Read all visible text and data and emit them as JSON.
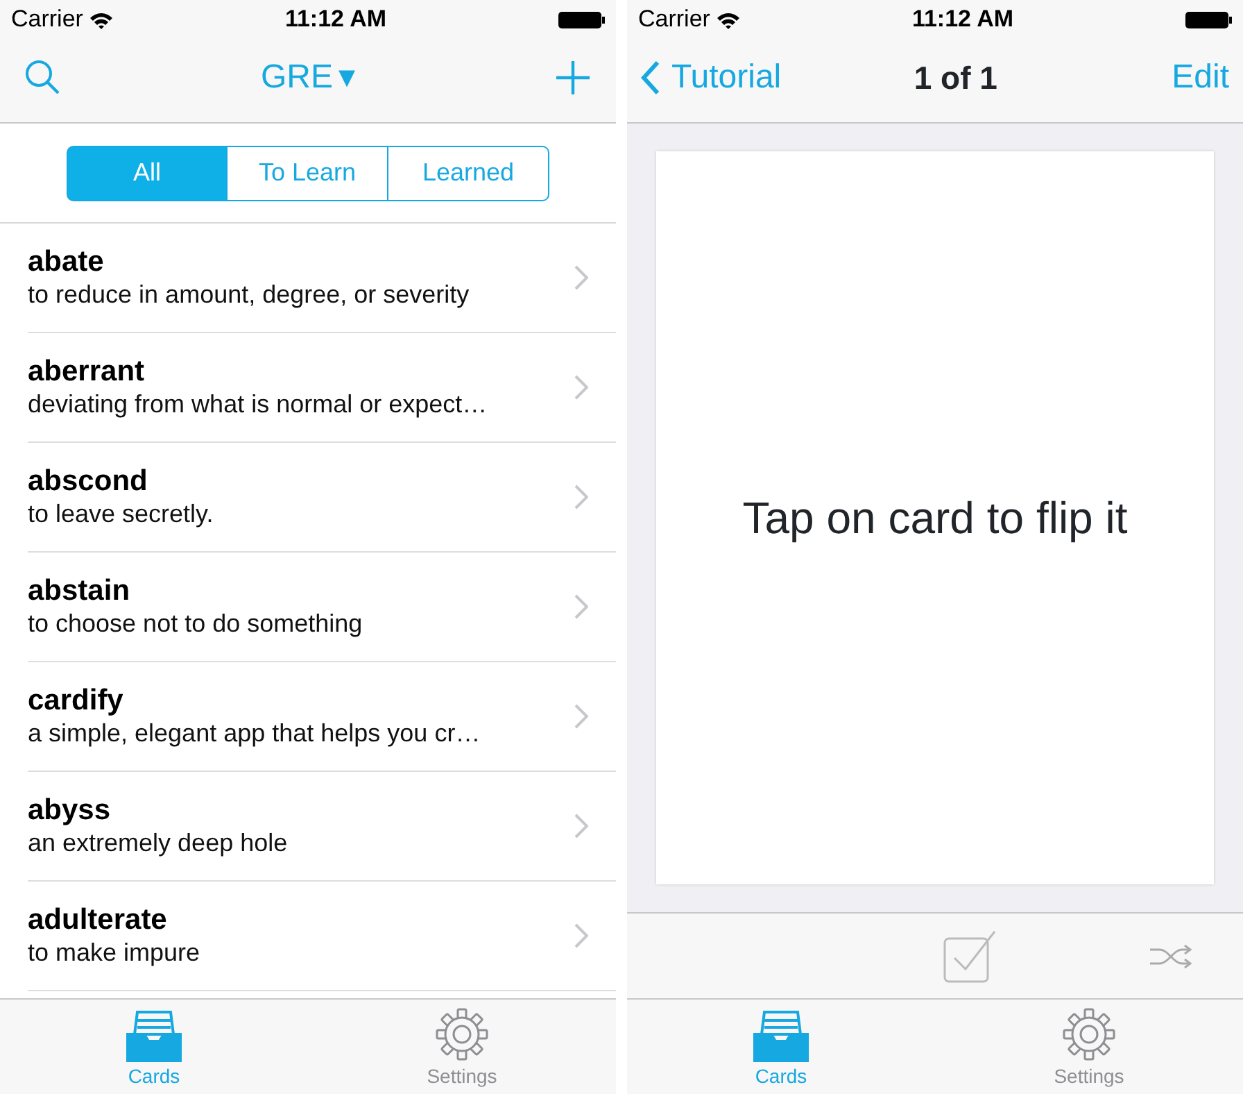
{
  "screens": [
    {
      "kind": "list",
      "status_bar": {
        "carrier": "Carrier",
        "time": "11:12 AM"
      },
      "nav": {
        "title": "GRE",
        "caret": "▾"
      },
      "segments": [
        {
          "label": "All",
          "selected": true
        },
        {
          "label": "To Learn",
          "selected": false
        },
        {
          "label": "Learned",
          "selected": false
        }
      ],
      "rows": [
        {
          "term": "abate",
          "definition": "to reduce in amount, degree, or  severity"
        },
        {
          "term": "aberrant",
          "definition": "deviating from what is normal or expect…"
        },
        {
          "term": "abscond",
          "definition": "to leave secretly."
        },
        {
          "term": "abstain",
          "definition": "to choose not to do something"
        },
        {
          "term": "cardify",
          "definition": "a simple, elegant app that helps you cr…"
        },
        {
          "term": "abyss",
          "definition": "an extremely deep hole"
        },
        {
          "term": "adulterate",
          "definition": "to make impure"
        }
      ],
      "tab_bar": [
        {
          "label": "Cards",
          "kind": "cards",
          "selected": true
        },
        {
          "label": "Settings",
          "kind": "settings",
          "selected": false
        }
      ]
    },
    {
      "kind": "card",
      "status_bar": {
        "carrier": "Carrier",
        "time": "11:12 AM"
      },
      "nav": {
        "back": "Tutorial",
        "title": "1 of 1",
        "action": "Edit"
      },
      "card_text": "Tap on card to flip it",
      "tab_bar": [
        {
          "label": "Cards",
          "kind": "cards",
          "selected": true
        },
        {
          "label": "Settings",
          "kind": "settings",
          "selected": false
        }
      ]
    }
  ]
}
